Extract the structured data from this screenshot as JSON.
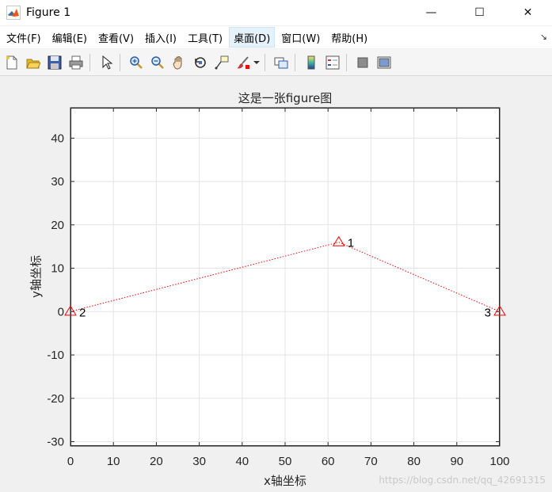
{
  "window": {
    "title": "Figure 1",
    "minimize": "—",
    "maximize": "☐",
    "close": "✕"
  },
  "menu": {
    "items": [
      "文件(F)",
      "编辑(E)",
      "查看(V)",
      "插入(I)",
      "工具(T)",
      "桌面(D)",
      "窗口(W)",
      "帮助(H)"
    ],
    "active": "桌面(D)",
    "overflow_arrow": "↘"
  },
  "toolbar": {
    "icons": [
      "new-figure-icon",
      "open-file-icon",
      "save-icon",
      "print-icon",
      "select-arrow-icon",
      "zoom-in-icon",
      "zoom-out-icon",
      "pan-hand-icon",
      "rotate-3d-icon",
      "data-cursor-icon",
      "brush-icon",
      "brush-dropdown-icon",
      "link-plot-icon",
      "colorbar-icon",
      "legend-icon",
      "hide-plot-tools-icon",
      "show-plot-tools-icon"
    ]
  },
  "watermark": "https://blog.csdn.net/qq_42691315",
  "chart_data": {
    "type": "line",
    "title": "这是一张figure图",
    "xlabel": "x轴坐标",
    "ylabel": "y轴坐标",
    "xlim": [
      0,
      100
    ],
    "ylim": [
      -31,
      47
    ],
    "xticks": [
      0,
      10,
      20,
      30,
      40,
      50,
      60,
      70,
      80,
      90,
      100
    ],
    "yticks": [
      -30,
      -20,
      -10,
      0,
      10,
      20,
      30,
      40
    ],
    "grid": true,
    "line_style": "dotted",
    "marker": "triangle-open",
    "color": "#ff0000",
    "points": [
      {
        "x": 0,
        "y": 0,
        "label": "2",
        "label_side": "right"
      },
      {
        "x": 62.5,
        "y": 16,
        "label": "1",
        "label_side": "right"
      },
      {
        "x": 100,
        "y": 0,
        "label": "3",
        "label_side": "left"
      }
    ]
  }
}
